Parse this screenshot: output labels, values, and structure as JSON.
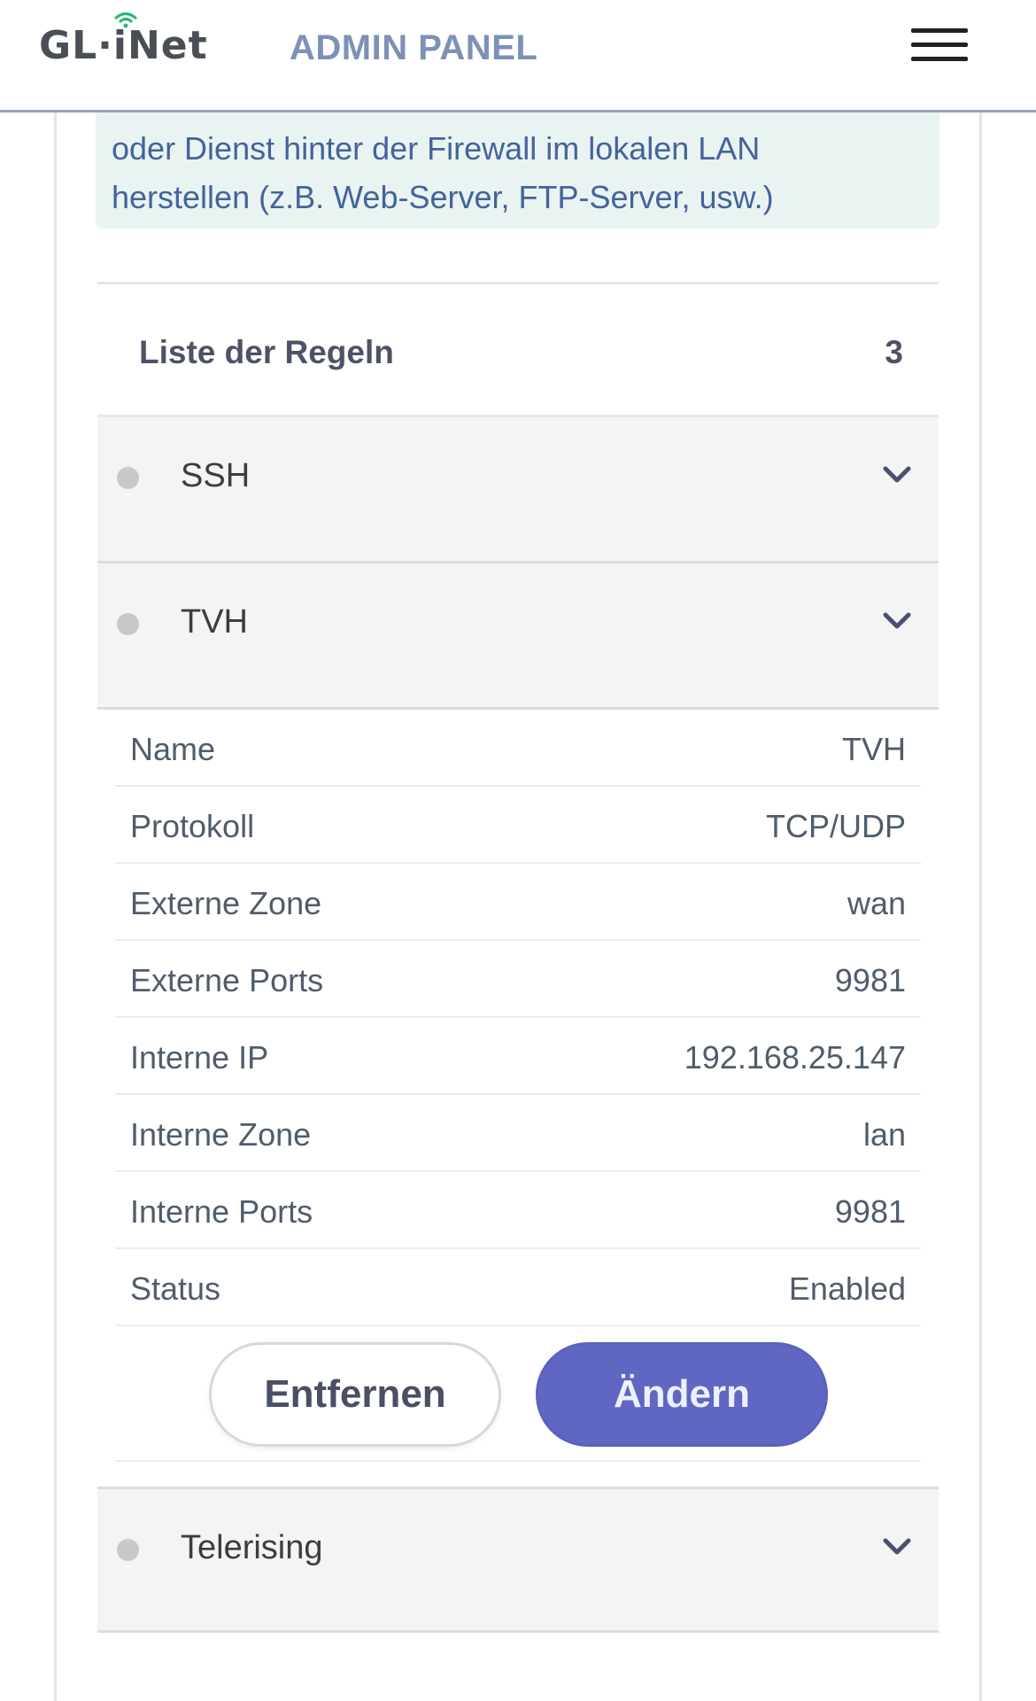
{
  "header": {
    "logo_text": "GL·iNet",
    "title": "ADMIN PANEL",
    "menu_icon": "hamburger-menu-icon"
  },
  "info": {
    "line1": "oder Dienst hinter der Firewall im lokalen LAN",
    "line2": "herstellen (z.B. Web-Server, FTP-Server, usw.)"
  },
  "rules": {
    "title": "Liste der Regeln",
    "count": "3",
    "items": [
      {
        "name": "SSH"
      },
      {
        "name": "TVH"
      },
      {
        "name": "Telerising"
      }
    ],
    "expanded": {
      "rows": [
        {
          "label": "Name",
          "value": "TVH"
        },
        {
          "label": "Protokoll",
          "value": "TCP/UDP"
        },
        {
          "label": "Externe Zone",
          "value": "wan"
        },
        {
          "label": "Externe Ports",
          "value": "9981"
        },
        {
          "label": "Interne IP",
          "value": "192.168.25.147"
        },
        {
          "label": "Interne Zone",
          "value": "lan"
        },
        {
          "label": "Interne Ports",
          "value": "9981"
        },
        {
          "label": "Status",
          "value": "Enabled"
        }
      ],
      "remove_label": "Entfernen",
      "edit_label": "Ändern"
    }
  },
  "colors": {
    "accent": "#5f67c2",
    "title": "#7d91b6",
    "info_bg": "#e9f4f2",
    "info_text": "#44639a"
  }
}
